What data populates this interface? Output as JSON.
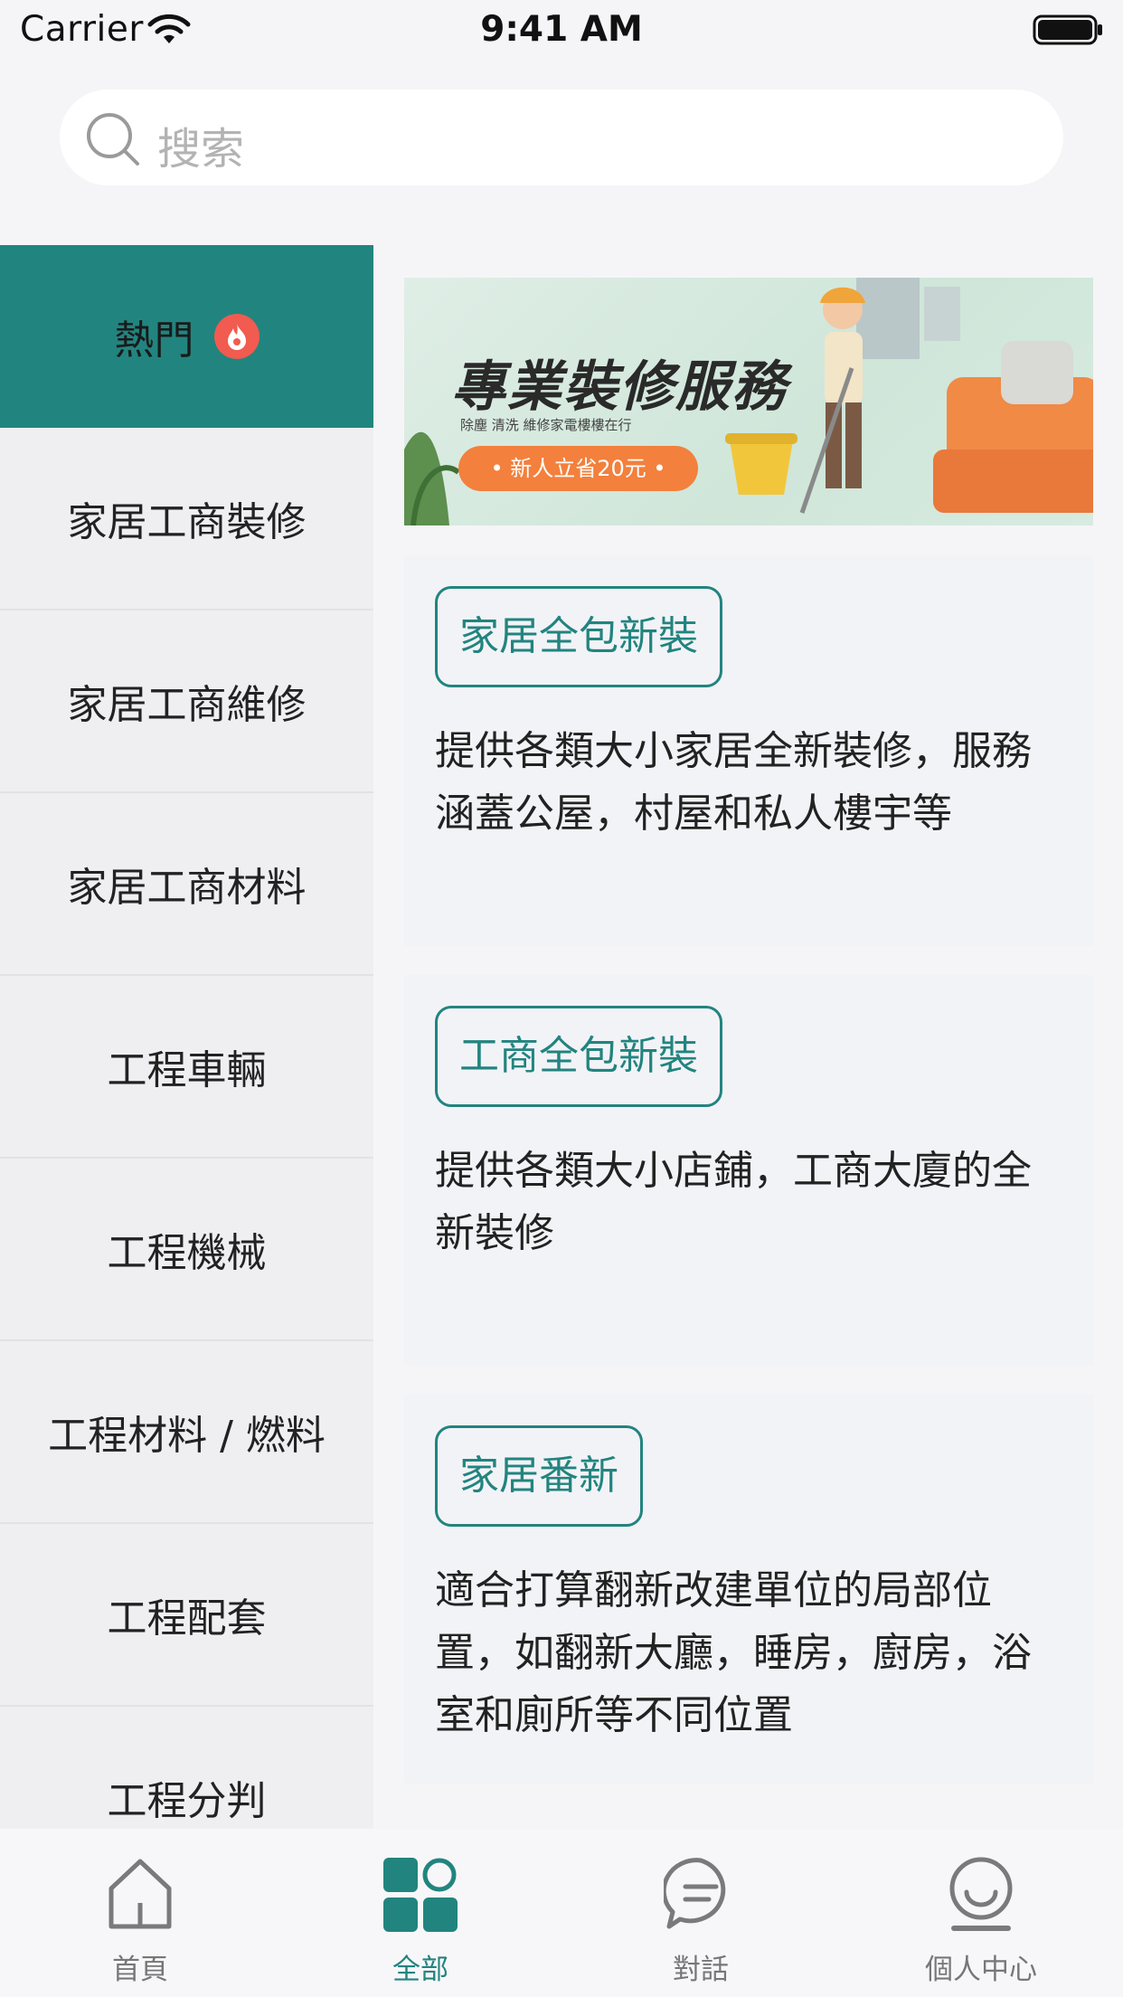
{
  "status_bar": {
    "carrier": "Carrier",
    "time": "9:41 AM",
    "wifi_icon": "wifi-icon",
    "battery_icon": "battery-icon"
  },
  "search": {
    "placeholder": "搜索",
    "icon": "search-icon"
  },
  "sidebar": {
    "items": [
      {
        "label": "熱門",
        "active": true,
        "badge_icon": "hot-flame-icon"
      },
      {
        "label": "家居工商裝修"
      },
      {
        "label": "家居工商維修"
      },
      {
        "label": "家居工商材料"
      },
      {
        "label": "工程車輛"
      },
      {
        "label": "工程機械"
      },
      {
        "label": "工程材料 / 燃料"
      },
      {
        "label": "工程配套"
      },
      {
        "label": "工程分判"
      }
    ]
  },
  "banner": {
    "title": "專業裝修服務",
    "subtitle": "除塵  清洗  維修家電樓樓在行",
    "promo": "• 新人立省20元 •"
  },
  "cards": [
    {
      "tag": "家居全包新裝",
      "description": "提供各類大小家居全新裝修，服務涵蓋公屋，村屋和私人樓宇等"
    },
    {
      "tag": "工商全包新裝",
      "description": "提供各類大小店鋪，工商大廈的全新裝修"
    },
    {
      "tag": "家居番新",
      "description": "適合打算翻新改建單位的局部位置，如翻新大廳，睡房，廚房，浴室和廁所等不同位置"
    }
  ],
  "tab_bar": {
    "tabs": [
      {
        "label": "首頁",
        "icon": "home-icon"
      },
      {
        "label": "全部",
        "icon": "grid-icon",
        "active": true
      },
      {
        "label": "對話",
        "icon": "chat-icon"
      },
      {
        "label": "個人中心",
        "icon": "profile-icon"
      }
    ]
  },
  "colors": {
    "accent": "#22847f",
    "background": "#f5f5f7",
    "sidebar_bg": "#efeff2",
    "hot_badge": "#f25b4f",
    "promo": "#f3803c"
  }
}
